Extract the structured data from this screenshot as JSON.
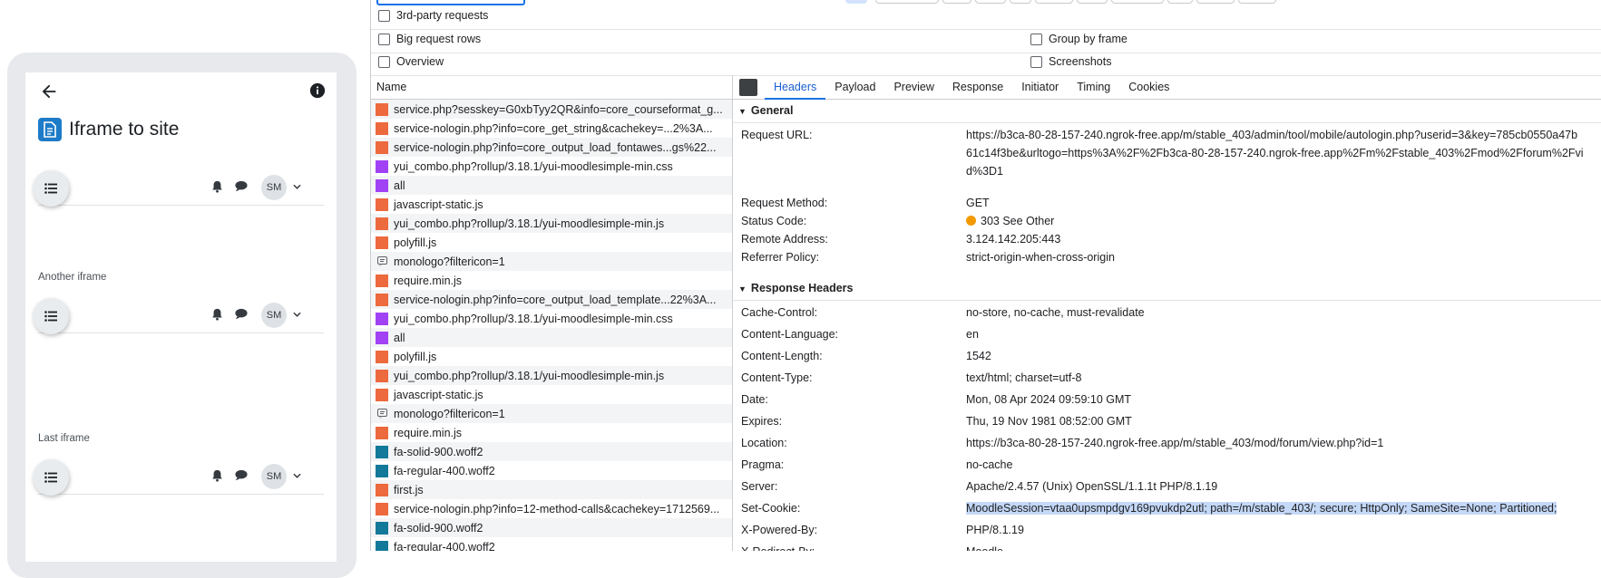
{
  "device": {
    "app_title": "Iframe to site",
    "avatar_initials": "SM",
    "frame_labels": [
      "Another iframe",
      "Last iframe"
    ]
  },
  "devtools": {
    "options": {
      "third_party": "3rd-party requests",
      "big_rows": "Big request rows",
      "overview": "Overview",
      "group_by_frame": "Group by frame",
      "screenshots": "Screenshots"
    },
    "name_column_header": "Name",
    "requests": [
      {
        "name": "service.php?sesskey=G0xbTyy2QR&info=core_courseformat_g...",
        "type": "xhr"
      },
      {
        "name": "service-nologin.php?info=core_get_string&cachekey=...2%3A...",
        "type": "xhr"
      },
      {
        "name": "service-nologin.php?info=core_output_load_fontawes...gs%22...",
        "type": "xhr"
      },
      {
        "name": "yui_combo.php?rollup/3.18.1/yui-moodlesimple-min.css",
        "type": "css"
      },
      {
        "name": "all",
        "type": "css"
      },
      {
        "name": "javascript-static.js",
        "type": "xhr"
      },
      {
        "name": "yui_combo.php?rollup/3.18.1/yui-moodlesimple-min.js",
        "type": "xhr"
      },
      {
        "name": "polyfill.js",
        "type": "xhr"
      },
      {
        "name": "monologo?filtericon=1",
        "type": "img"
      },
      {
        "name": "require.min.js",
        "type": "xhr"
      },
      {
        "name": "service-nologin.php?info=core_output_load_template...22%3A...",
        "type": "xhr"
      },
      {
        "name": "yui_combo.php?rollup/3.18.1/yui-moodlesimple-min.css",
        "type": "css"
      },
      {
        "name": "all",
        "type": "css"
      },
      {
        "name": "polyfill.js",
        "type": "xhr"
      },
      {
        "name": "yui_combo.php?rollup/3.18.1/yui-moodlesimple-min.js",
        "type": "xhr"
      },
      {
        "name": "javascript-static.js",
        "type": "xhr"
      },
      {
        "name": "monologo?filtericon=1",
        "type": "img"
      },
      {
        "name": "require.min.js",
        "type": "xhr"
      },
      {
        "name": "fa-solid-900.woff2",
        "type": "font"
      },
      {
        "name": "fa-regular-400.woff2",
        "type": "font"
      },
      {
        "name": "first.js",
        "type": "xhr"
      },
      {
        "name": "service-nologin.php?info=12-method-calls&cachekey=1712569...",
        "type": "xhr"
      },
      {
        "name": "fa-solid-900.woff2",
        "type": "font"
      },
      {
        "name": "fa-regular-400.woff2",
        "type": "font"
      }
    ],
    "type_colors": {
      "xhr": "#ec6a3e",
      "css": "#a142f4",
      "font": "#12799a"
    },
    "tabs": [
      "Headers",
      "Payload",
      "Preview",
      "Response",
      "Initiator",
      "Timing",
      "Cookies"
    ],
    "active_tab": "Headers",
    "general": {
      "title": "General",
      "request_url_label": "Request URL:",
      "request_url": "https://b3ca-80-28-157-240.ngrok-free.app/m/stable_403/admin/tool/mobile/autologin.php?userid=3&key=785cb0550a47b61c14f3be&urltogo=https%3A%2F%2Fb3ca-80-28-157-240.ngrok-free.app%2Fm%2Fstable_403%2Fmod%2Fforum%2Fvid%3D1",
      "request_url_lines": [
        "https://b3ca-80-28-157-240.ngrok-free.app/m/stable_403/admin/tool/mobile/autologin.php?userid=3&key=785cb0550a47b",
        "61c14f3be&urltogo=https%3A%2F%2Fb3ca-80-28-157-240.ngrok-free.app%2Fm%2Fstable_403%2Fmod%2Fforum%2Fvi",
        "d%3D1"
      ],
      "rows": [
        {
          "key": "Request Method:",
          "value": "GET"
        },
        {
          "key": "Status Code:",
          "value": "303 See Other"
        },
        {
          "key": "Remote Address:",
          "value": "3.124.142.205:443"
        },
        {
          "key": "Referrer Policy:",
          "value": "strict-origin-when-cross-origin"
        }
      ]
    },
    "response_headers": {
      "title": "Response Headers",
      "rows": [
        {
          "key": "Cache-Control:",
          "value": "no-store, no-cache, must-revalidate"
        },
        {
          "key": "Content-Language:",
          "value": "en"
        },
        {
          "key": "Content-Length:",
          "value": "1542"
        },
        {
          "key": "Content-Type:",
          "value": "text/html; charset=utf-8"
        },
        {
          "key": "Date:",
          "value": "Mon, 08 Apr 2024 09:59:10 GMT"
        },
        {
          "key": "Expires:",
          "value": "Thu, 19 Nov 1981 08:52:00 GMT"
        },
        {
          "key": "Location:",
          "value": "https://b3ca-80-28-157-240.ngrok-free.app/m/stable_403/mod/forum/view.php?id=1"
        },
        {
          "key": "Pragma:",
          "value": "no-cache"
        },
        {
          "key": "Server:",
          "value": "Apache/2.4.57 (Unix) OpenSSL/1.1.1t PHP/8.1.19"
        },
        {
          "key": "Set-Cookie:",
          "value": "MoodleSession=vtaa0upsmpdgv169pvukdp2utl; path=/m/stable_403/; secure; HttpOnly; SameSite=None; Partitioned;"
        },
        {
          "key": "X-Powered-By:",
          "value": "PHP/8.1.19"
        },
        {
          "key": "X-Redirect-By:",
          "value": "Moodle"
        }
      ]
    }
  }
}
